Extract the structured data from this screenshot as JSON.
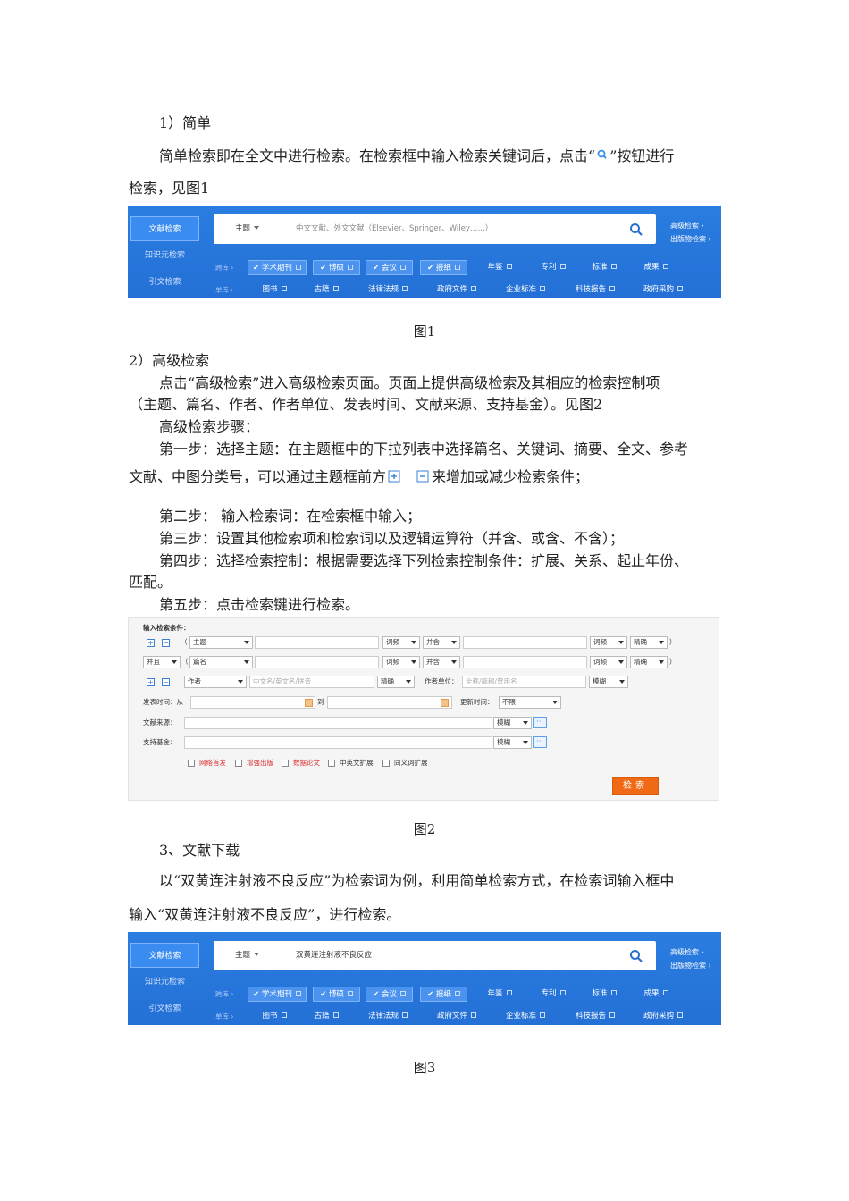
{
  "doc": {
    "s1_heading": "1）简单",
    "s1_para_line1": "简单检索即在全文中进行检索。在检索框中输入检索关键词后，点击“",
    "s1_para_line1_tail": "”按钮进行",
    "s1_para_line2": "检索，见图1",
    "fig1": "图1",
    "s2_heading": "2）高级检索",
    "s2_p1_line1": "点击“高级检索”进入高级检索页面。页面上提供高级检索及其相应的检索控制项",
    "s2_p1_line2": "（主题、篇名、作者、作者单位、发表时间、文献来源、支持基金）。见图2",
    "s2_steps_title": "高级检索步骤：",
    "step1_line1": "第一步：选择主题：在主题框中的下拉列表中选择篇名、关键词、摘要、全文、参考",
    "step1_line2a": "文献、中图分类号，可以通过主题框前方",
    "step1_line2b": "来增加或减少检索条件；",
    "step2": "第二步：  输入检索词：在检索框中输入；",
    "step3": "第三步：设置其他检索项和检索词以及逻辑运算符（并含、或含、不含）；",
    "step4_line1": "第四步：选择检索控制：根据需要选择下列检索控制条件：扩展、关系、起止年份、",
    "step4_line2": "匹配。",
    "step5": "第五步：点击检索键进行检索。",
    "fig2": "图2",
    "s3_heading": "3、文献下载",
    "s3_line1": "以“双黄连注射液不良反应”为检索词为例，利用简单检索方式，在检索词输入框中",
    "s3_line2": "输入“双黄连注射液不良反应”，进行检索。",
    "fig3": "图3"
  },
  "banner": {
    "tabs": [
      "文献检索",
      "知识元检索",
      "引文检索"
    ],
    "field": "主题",
    "placeholder": "中文文献、外文文献（Elsevier、Springer、Wiley……）",
    "query": "双黄连注射液不良反应",
    "adv1": "高级检索  ›",
    "adv2": "出版物检索  ›",
    "row1_label": "跨库 ›",
    "row1_checked": [
      "学术期刊",
      "博硕",
      "会议",
      "报纸"
    ],
    "row1_plain": [
      "年鉴",
      "专利",
      "标准",
      "成果"
    ],
    "row2_label": "单库 ›",
    "row2": [
      "图书",
      "古籍",
      "法律法规",
      "政府文件",
      "企业标准",
      "科技报告",
      "政府采购"
    ]
  },
  "adv": {
    "title": "输入检索条件：",
    "r1": [
      "主题",
      "词频",
      "并含",
      "词频",
      "精确"
    ],
    "r2": [
      "并且",
      "篇名",
      "词频",
      "并含",
      "词频",
      "精确"
    ],
    "r3_author": "作者",
    "r3_author_ph": "中文名/英文名/拼音",
    "r3_match": "精确",
    "r3_unit_label": "作者单位：",
    "r3_unit_ph": "全称/简称/曾用名",
    "r3_unit_match": "模糊",
    "pub_label": "发表时间：从",
    "to": "到",
    "update_label": "更新时间：",
    "update_val": "不限",
    "source_label": "文献来源：",
    "fund_label": "支持基金：",
    "fuzzy": "模糊",
    "checks": [
      "网络首发",
      "增强出版",
      "数据论文",
      "中英文扩展",
      "同义词扩展"
    ],
    "search_btn": "检索",
    "paren_open": "（",
    "paren_close": "）"
  }
}
